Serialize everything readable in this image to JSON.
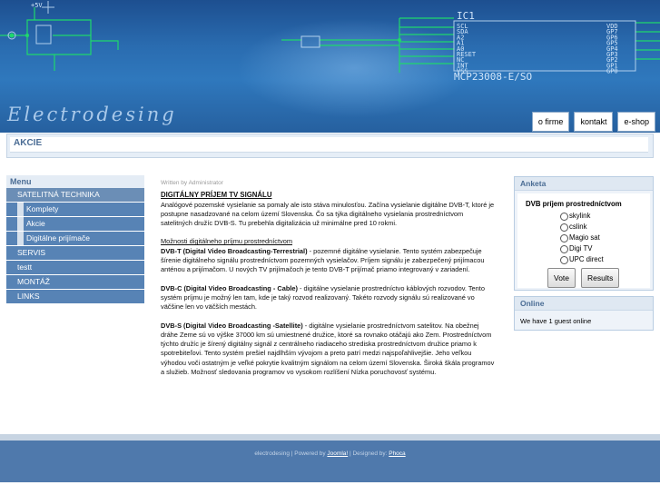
{
  "header": {
    "site_name": "Electrodesing",
    "nav": [
      "o firme",
      "kontakt",
      "e-shop"
    ],
    "circuit": {
      "chip_name": "IC1",
      "chip_part": "MCP23008-E/SO",
      "left_pins": [
        "SCL",
        "SDA",
        "A2",
        "A1",
        "A0",
        "RESET",
        "NC",
        "INT",
        "VSS"
      ],
      "right_pins": [
        "VDD",
        "GP7",
        "GP6",
        "GP5",
        "GP4",
        "GP3",
        "GP2",
        "GP1",
        "GP0"
      ],
      "voltage": "+5V"
    }
  },
  "breadcrumb": "AKCIE",
  "menu": {
    "title": "Menu",
    "items": [
      {
        "label": "SATELITNÁ TECHNIKA",
        "level": 0
      },
      {
        "label": "Komplety",
        "level": 1
      },
      {
        "label": "Akcie",
        "level": 1
      },
      {
        "label": "Digitálne prijímače",
        "level": 1
      },
      {
        "label": "SERVIS",
        "level": 0
      },
      {
        "label": "testt",
        "level": 0
      },
      {
        "label": "MONTÁŽ",
        "level": 0
      },
      {
        "label": "LINKS",
        "level": 0
      }
    ]
  },
  "article": {
    "author": "Written by Administrator",
    "title": "DIGITÁLNY PRÍJEM TV SIGNÁLU",
    "intro": "Analógové pozemské vysielanie sa pomaly ale isto stáva minulosťou. Začína vysielanie digitálne DVB-T, ktoré je postupne nasadzované na celom území Slovenska. Čo sa týka digitálneho vysielania prostredníctvom",
    "intro2": "satelitných družíc DVB-S. Tu prebehla digitalizácia už minimálne pred 10 rokmi.",
    "subhead": "Možnosti digitálneho príjmu prostredníctvom",
    "dvbt_head": "DVB-T (Digital Video Broadcasting-Terrestrial)",
    "dvbt_text": " - pozemné digitálne vysielanie. Tento systém zabezpečuje šírenie digitálneho signálu prostredníctvom pozemných vysielačov. Príjem signálu je zabezpečený prijímacou anténou a prijímačom. U nových TV prijímačoch je tento DVB-T prijímač priamo integrovaný v zariadení.",
    "dvbc_head": "DVB-C (Digital Video Broadcasting - Cable)",
    "dvbc_text": " - digitálne vysielanie prostredníctvo káblových rozvodov. Tento systém príjmu je možný len tam, kde je taký rozvod realizovaný. Takéto rozvody signálu sú realizované vo väčšine len vo väčších mestách.",
    "dvbs_head": "DVB-S (Digital Video Broadcasting -Satellite)",
    "dvbs_text": " - digitálne vysielanie prostredníctvom satelitov. Na obežnej dráhe Zeme sú vo výške 37000 km sú umiestnené družice, ktoré sa rovnako otáčajú ako Zem. Prostredníctvom týchto družíc je šírený digitálny signál z centrálneho riadiaceho strediska prostredníctvom družice priamo k spotrebiteľovi. Tento systém prešiel najdlhším vývojom a preto patrí medzi najspoľahlivejšie. Jeho veľkou výhodou voči ostatným je veľké pokrytie kvalitným signálom na celom území Slovenska. Široká škála programov a služieb. Možnosť sledovania programov vo vysokom rozlíšení Nízka poruchovosť systému."
  },
  "poll": {
    "title": "Anketa",
    "question": "DVB príjem prostredníctvom",
    "options": [
      "skylink",
      "cslink",
      "Magio sat",
      "Digi TV",
      "UPC direct"
    ],
    "vote_label": "Vote",
    "results_label": "Results"
  },
  "online": {
    "title": "Online",
    "text": "We have 1 guest online"
  },
  "footer": {
    "prefix": "electrodesing | Powered by ",
    "link1": "Joomla!",
    "middle": " | Designed by: ",
    "link2": "Phoca"
  }
}
